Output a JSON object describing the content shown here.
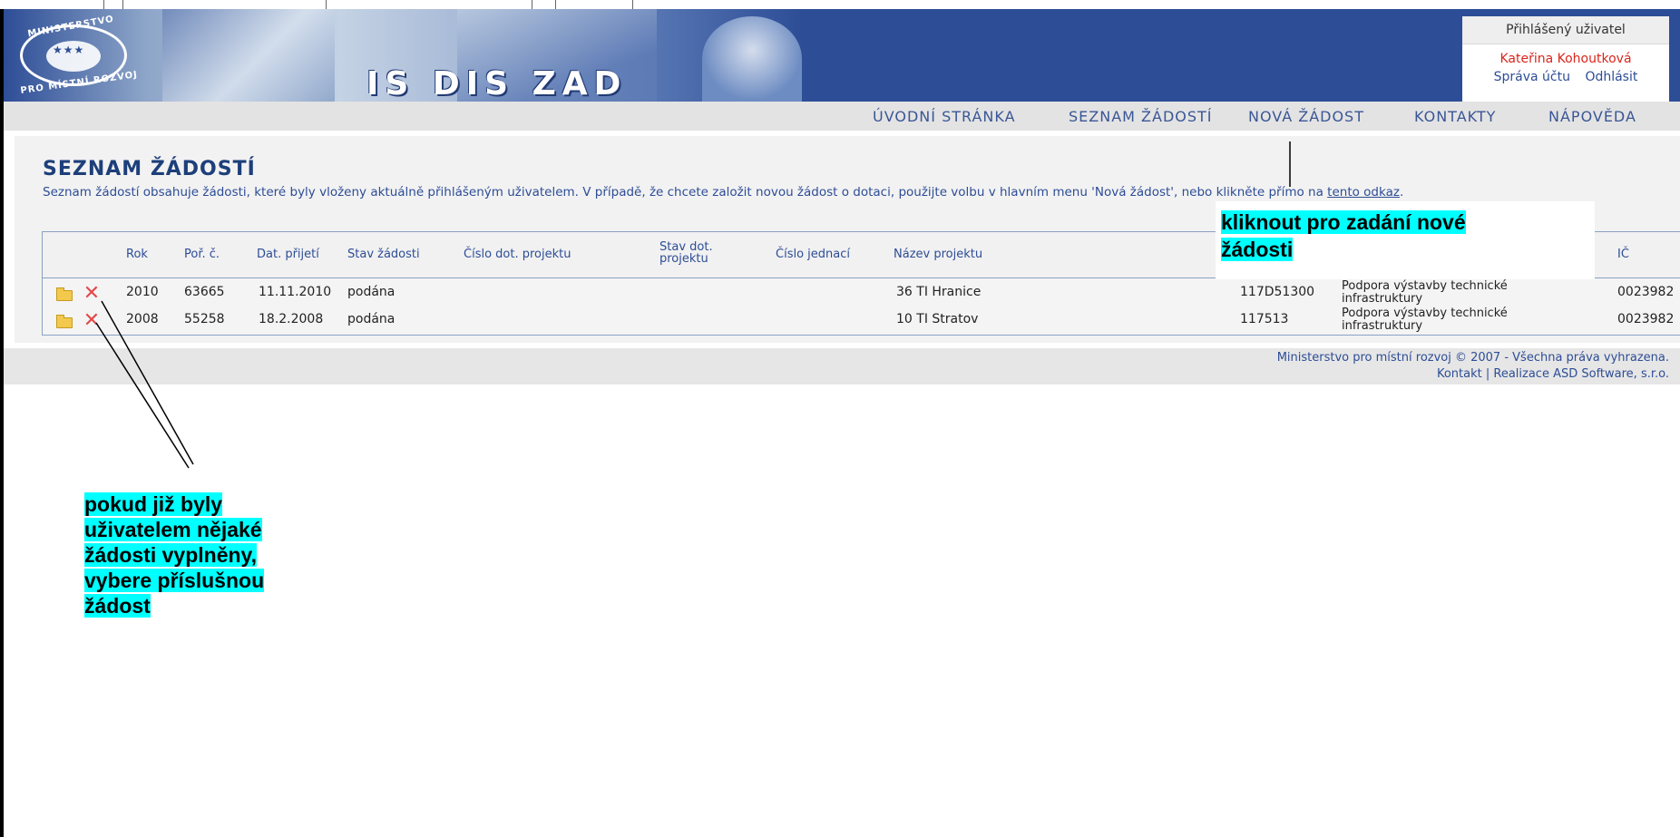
{
  "header": {
    "logo_top": "MINISTERSTVO",
    "logo_bottom": "PRO MÍSTNÍ ROZVOJ",
    "app_title": "IS DIS ZAD",
    "user_box_title": "Přihlášený uživatel",
    "user_name": "Kateřina Kohoutková",
    "account_link": "Správa účtu",
    "logout_link": "Odhlásit"
  },
  "nav": {
    "items": [
      "ÚVODNÍ STRÁNKA",
      "SEZNAM ŽÁDOSTÍ",
      "NOVÁ ŽÁDOST",
      "KONTAKTY",
      "NÁPOVĚDA"
    ]
  },
  "page": {
    "title": "SEZNAM ŽÁDOSTÍ",
    "desc_text": "Seznam žádostí obsahuje žádosti, které byly vloženy aktuálně přihlášeným uživatelem. V případě, že chcete založit novou žádost o dotaci, použijte volbu v hlavním menu 'Nová žádost', nebo klikněte přímo na ",
    "desc_link": "tento odkaz",
    "desc_end": "."
  },
  "table": {
    "headers": {
      "rok": "Rok",
      "por": "Poř. č.",
      "dat": "Dat. přijetí",
      "stav": "Stav žádosti",
      "cislo_dot": "Číslo dot. projektu",
      "stav_dot": "Stav dot. projektu",
      "jednaci": "Číslo jednací",
      "nazev": "Název projektu",
      "ic": "IČ"
    },
    "rows": [
      {
        "rok": "2010",
        "por": "63665",
        "dat": "11.11.2010",
        "stav": "podána",
        "nazev": "36 TI Hranice",
        "kod": "117D51300",
        "program": "Podpora výstavby technické infrastruktury",
        "ic": "0023982"
      },
      {
        "rok": "2008",
        "por": "55258",
        "dat": "18.2.2008",
        "stav": "podána",
        "nazev": "10 TI Stratov",
        "kod": "117513",
        "program": "Podpora výstavby technické infrastruktury",
        "ic": "0023982"
      }
    ]
  },
  "footer": {
    "line1": "Ministerstvo pro místní rozvoj © 2007 - Všechna práva vyhrazena.",
    "contact": "Kontakt",
    "separator": " | ",
    "realization": "Realizace ASD Software, s.r.o."
  },
  "annotations": {
    "new_request_line1": "kliknout pro zadání nové",
    "new_request_line2": "žádosti",
    "select_request_lines": [
      "pokud již byly",
      "uživatelem nějaké",
      "žádosti vyplněny,",
      "vybere příslušnou",
      "žádost"
    ]
  },
  "colors": {
    "header_blue": "#2d4d96",
    "highlight": "#00ffff",
    "user_name_red": "#d9261c"
  }
}
